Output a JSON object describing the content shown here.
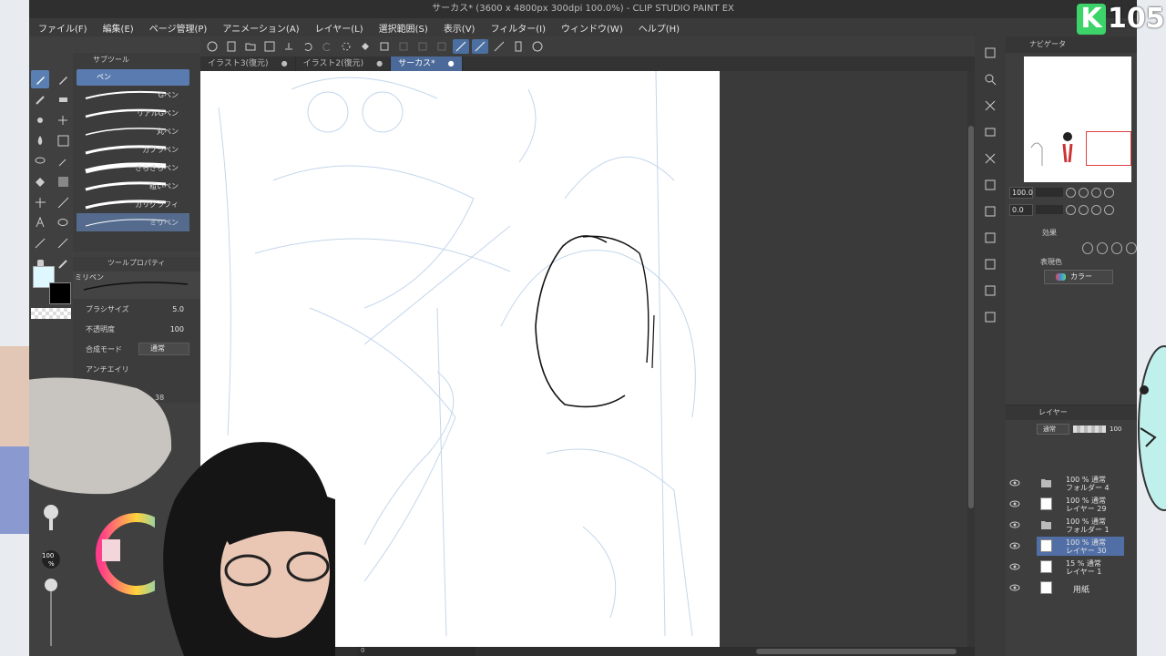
{
  "app": {
    "title": "サーカス* (3600 x 4800px 300dpi 100.0%) - CLIP STUDIO PAINT EX",
    "logo": {
      "letter": "K",
      "number": "105"
    }
  },
  "menu": [
    "ファイル(F)",
    "編集(E)",
    "ページ管理(P)",
    "アニメーション(A)",
    "レイヤー(L)",
    "選択範囲(S)",
    "表示(V)",
    "フィルター(I)",
    "ウィンドウ(W)",
    "ヘルプ(H)"
  ],
  "tabs": [
    {
      "label": "イラスト3(復元)",
      "active": false
    },
    {
      "label": "イラスト2(復元)",
      "active": false
    },
    {
      "label": "サーカス*",
      "active": true
    }
  ],
  "subtool": {
    "title": "サブツール",
    "group": "ペン",
    "brushes": [
      "Gペン",
      "リアルGペン",
      "丸ペン",
      "カブラペン",
      "さらさらペン",
      "粗いペン",
      "カリグラフィ",
      "ミリペン"
    ],
    "selected_index": 7
  },
  "toolprop": {
    "title": "ツールプロパティ",
    "brush_name": "ミリペン",
    "size_label": "ブラシサイズ",
    "size_value": "5.0",
    "opacity_label": "不透明度",
    "opacity_value": "100",
    "blend_label": "合成モード",
    "blend_value": "通常",
    "aa_label": "アンチエイリ"
  },
  "colors": {
    "fg": "#dff8ff",
    "bg": "#000000",
    "accent": "#4b6a99"
  },
  "left_overlay": {
    "size_value": "100",
    "size_unit": "%",
    "partial_value": "38"
  },
  "navigator": {
    "title": "ナビゲータ",
    "zoom": "100.0",
    "angle": "0.0"
  },
  "effect": {
    "title": "効果",
    "display_label": "表現色",
    "display_value": "カラー"
  },
  "layers": {
    "title": "レイヤー",
    "blend": "通常",
    "opacity": "100",
    "items": [
      {
        "line1": "100 % 通常",
        "line2": "フォルダー 4",
        "type": "folder",
        "selected": false
      },
      {
        "line1": "100 % 通常",
        "line2": "レイヤー 29",
        "type": "layer",
        "selected": false
      },
      {
        "line1": "100 % 通常",
        "line2": "フォルダー 1",
        "type": "folder",
        "selected": false
      },
      {
        "line1": "100 % 通常",
        "line2": "レイヤー 30",
        "type": "layer",
        "selected": true
      },
      {
        "line1": "15 % 通常",
        "line2": "レイヤー 1",
        "type": "layer",
        "selected": false
      },
      {
        "line1": "",
        "line2": "用紙",
        "type": "paper",
        "selected": false
      }
    ]
  },
  "bottom_status": {
    "zoom": "0"
  }
}
